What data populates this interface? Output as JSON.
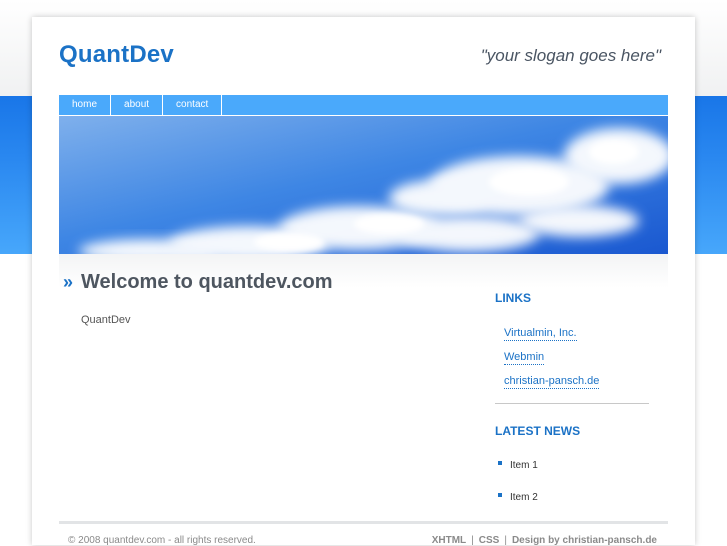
{
  "site": {
    "logo": "QuantDev",
    "slogan": "\"your slogan goes here\""
  },
  "nav": {
    "items": [
      "home",
      "about",
      "contact"
    ]
  },
  "main": {
    "heading_marker": "»",
    "heading": "Welcome to quantdev.com",
    "intro": "QuantDev"
  },
  "sidebar": {
    "links_title": "LINKS",
    "links": [
      "Virtualmin, Inc.",
      "Webmin",
      "christian-pansch.de"
    ],
    "news_title": "LATEST NEWS",
    "news": [
      "Item 1",
      "Item 2"
    ]
  },
  "footer": {
    "copyright": "© 2008 quantdev.com - all rights reserved.",
    "xhtml": "XHTML",
    "css": "CSS",
    "separator": "|",
    "design": "Design by christian-pansch.de"
  },
  "colors": {
    "brand": "#1b72c6",
    "nav": "#4aa9fb",
    "band": "#2a88f0"
  }
}
